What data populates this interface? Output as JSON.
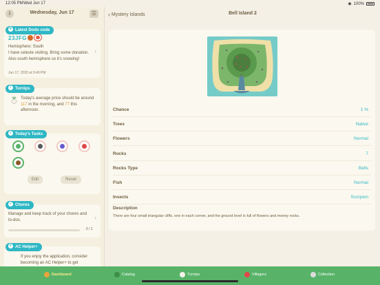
{
  "status_bar": {
    "time": "12:05 PM",
    "date": "Wed Jun 17",
    "battery": "100%"
  },
  "left": {
    "title": "Wednesday, Jun 17",
    "dodo": {
      "pill": "Latest Dodo code",
      "code": "23JFG",
      "hemisphere": "Hemisphere: South",
      "message": "I have celeste visiting. Bring some donation. Also south hemisphere so it's snowing!",
      "timestamp": "Jun 17, 2020 at 9:49 PM"
    },
    "turnips": {
      "pill": "Turnips",
      "text_a": "Today's average price should be around ",
      "morning": "117",
      "text_b": " in the morning, and ",
      "afternoon": "77",
      "text_c": " this afternoon."
    },
    "tasks": {
      "pill": "Today's Tasks",
      "edit": "Edit",
      "reset": "Reset"
    },
    "chores": {
      "pill": "Chores",
      "text": "Manage and keep track of your chores and to-dos.",
      "count": "0 / 1",
      "progress": 0
    },
    "helper": {
      "pill": "AC Helper+",
      "text": "If you enjoy the application, consider becoming an AC Helper+ to get"
    }
  },
  "right": {
    "back_label": "Mystery Islands",
    "title": "Bell Island 2",
    "rows": [
      {
        "label": "Chance",
        "value": "1 %"
      },
      {
        "label": "Trees",
        "value": "Native"
      },
      {
        "label": "Flowers",
        "value": "Normal"
      },
      {
        "label": "Rocks",
        "value": "7"
      },
      {
        "label": "Rocks Type",
        "value": "Bells"
      },
      {
        "label": "Fish",
        "value": "Normal"
      },
      {
        "label": "Insects",
        "value": "Scorpion"
      }
    ],
    "description_label": "Description",
    "description": "There are four small triangular cliffs, one in each corner, and the ground level is full of flowers and money rocks."
  },
  "tabs": [
    {
      "label": "Dashboard",
      "active": true
    },
    {
      "label": "Catalog",
      "active": false
    },
    {
      "label": "Turnips",
      "active": false
    },
    {
      "label": "Villagers",
      "active": false
    },
    {
      "label": "Collection",
      "active": false
    }
  ],
  "colors": {
    "accent": "#2fb7c4",
    "tabbar": "#58b368",
    "highlight": "#d99a2b"
  }
}
